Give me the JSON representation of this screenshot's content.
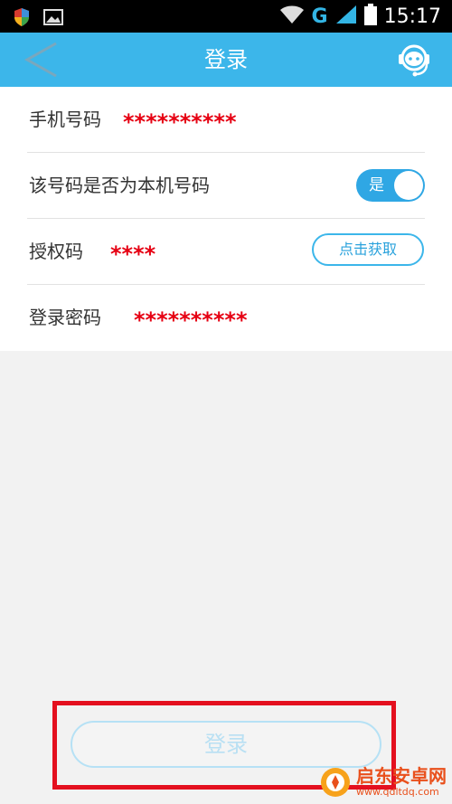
{
  "status_bar": {
    "network_type": "G",
    "time": "15:17",
    "icons": [
      "shield-app-icon",
      "image-notification-icon",
      "wifi-icon",
      "signal-icon",
      "battery-icon"
    ]
  },
  "header": {
    "title": "登录",
    "back_icon": "chevron-left-icon",
    "service_icon": "customer-service-icon"
  },
  "form": {
    "phone": {
      "label": "手机号码",
      "value": "**********"
    },
    "is_own_number": {
      "label": "该号码是否为本机号码",
      "toggle_label": "是",
      "toggle_on": true
    },
    "auth_code": {
      "label": "授权码",
      "value": "****",
      "button_label": "点击获取"
    },
    "password": {
      "label": "登录密码",
      "value": "**********"
    }
  },
  "login_button": {
    "label": "登录"
  },
  "watermark": {
    "name": "启东安卓网",
    "url": "www.qdltdq.com"
  },
  "colors": {
    "accent": "#3cb6ea",
    "masked_value": "#e60012",
    "highlight_box": "#e4101f"
  }
}
